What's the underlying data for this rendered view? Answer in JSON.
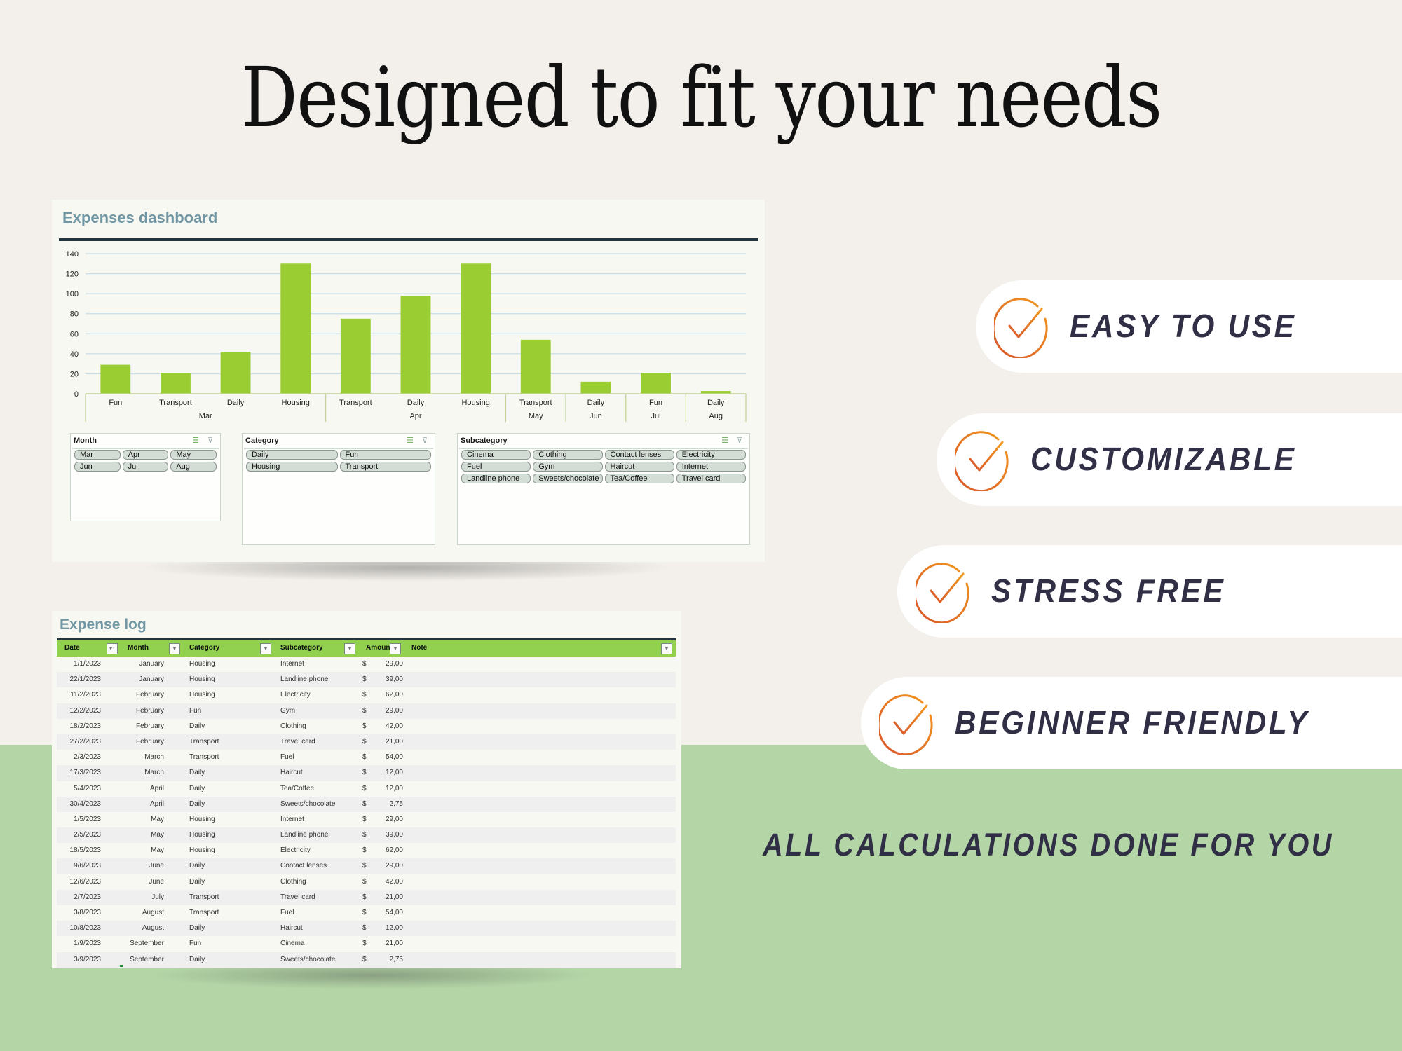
{
  "headline": "Designed to fit your needs",
  "dashboard": {
    "title": "Expenses dashboard",
    "slicers": [
      {
        "title": "Month",
        "columns": 3,
        "items": [
          "Mar",
          "Apr",
          "May",
          "Jun",
          "Jul",
          "Aug"
        ]
      },
      {
        "title": "Category",
        "columns": 2,
        "items": [
          "Daily",
          "Fun",
          "Housing",
          "Transport"
        ]
      },
      {
        "title": "Subcategory",
        "columns": 4,
        "items": [
          "Cinema",
          "Clothing",
          "Contact lenses",
          "Electricity",
          "Fuel",
          "Gym",
          "Haircut",
          "Internet",
          "Landline phone",
          "Sweets/chocolate",
          "Tea/Coffee",
          "Travel card"
        ]
      }
    ],
    "slicer_icons": {
      "multi_select": "multi-select-icon",
      "clear_filter": "clear-filter-icon"
    }
  },
  "chart_data": {
    "type": "bar",
    "title": "",
    "xlabel": "",
    "ylabel": "",
    "ylim": [
      0,
      140
    ],
    "yticks": [
      0,
      20,
      40,
      60,
      80,
      100,
      120,
      140
    ],
    "grid": true,
    "bar_color": "#9acd32",
    "categories": [
      "Fun",
      "Transport",
      "Daily",
      "Housing",
      "Transport",
      "Daily",
      "Housing",
      "Transport",
      "Daily",
      "Fun",
      "Daily"
    ],
    "groups": [
      {
        "label": "Mar",
        "count": 4
      },
      {
        "label": "Apr",
        "count": 3
      },
      {
        "label": "May",
        "count": 1
      },
      {
        "label": "Jun",
        "count": 1
      },
      {
        "label": "Jul",
        "count": 1
      },
      {
        "label": "Aug",
        "count": 1
      }
    ],
    "values": [
      29,
      21,
      42,
      130,
      75,
      98,
      130,
      54,
      12,
      21,
      2.75
    ]
  },
  "expense_log": {
    "title": "Expense log",
    "columns": [
      "Date",
      "Month",
      "Category",
      "Subcategory",
      "Amount",
      "Note"
    ],
    "currency": "$",
    "rows": [
      [
        "1/1/2023",
        "January",
        "Housing",
        "Internet",
        "29,00"
      ],
      [
        "22/1/2023",
        "January",
        "Housing",
        "Landline phone",
        "39,00"
      ],
      [
        "11/2/2023",
        "February",
        "Housing",
        "Electricity",
        "62,00"
      ],
      [
        "12/2/2023",
        "February",
        "Fun",
        "Gym",
        "29,00"
      ],
      [
        "18/2/2023",
        "February",
        "Daily",
        "Clothing",
        "42,00"
      ],
      [
        "27/2/2023",
        "February",
        "Transport",
        "Travel card",
        "21,00"
      ],
      [
        "2/3/2023",
        "March",
        "Transport",
        "Fuel",
        "54,00"
      ],
      [
        "17/3/2023",
        "March",
        "Daily",
        "Haircut",
        "12,00"
      ],
      [
        "5/4/2023",
        "April",
        "Daily",
        "Tea/Coffee",
        "12,00"
      ],
      [
        "30/4/2023",
        "April",
        "Daily",
        "Sweets/chocolate",
        "2,75"
      ],
      [
        "1/5/2023",
        "May",
        "Housing",
        "Internet",
        "29,00"
      ],
      [
        "2/5/2023",
        "May",
        "Housing",
        "Landline phone",
        "39,00"
      ],
      [
        "18/5/2023",
        "May",
        "Housing",
        "Electricity",
        "62,00"
      ],
      [
        "9/6/2023",
        "June",
        "Daily",
        "Contact lenses",
        "29,00"
      ],
      [
        "12/6/2023",
        "June",
        "Daily",
        "Clothing",
        "42,00"
      ],
      [
        "2/7/2023",
        "July",
        "Transport",
        "Travel card",
        "21,00"
      ],
      [
        "3/8/2023",
        "August",
        "Transport",
        "Fuel",
        "54,00"
      ],
      [
        "10/8/2023",
        "August",
        "Daily",
        "Haircut",
        "12,00"
      ],
      [
        "1/9/2023",
        "September",
        "Fun",
        "Cinema",
        "21,00"
      ],
      [
        "3/9/2023",
        "September",
        "Daily",
        "Sweets/chocolate",
        "2,75"
      ]
    ]
  },
  "features": [
    {
      "label": "EASY TO USE",
      "icon": "check-circle-icon"
    },
    {
      "label": "CUSTOMIZABLE",
      "icon": "check-circle-icon"
    },
    {
      "label": "STRESS FREE",
      "icon": "check-circle-icon"
    },
    {
      "label": "BEGINNER FRIENDLY",
      "icon": "check-circle-icon"
    }
  ],
  "footer_tagline": "ALL CALCULATIONS DONE FOR YOU",
  "colors": {
    "background": "#f3f0eb",
    "green_band": "#b4d6a7",
    "table_header": "#92d050",
    "panel_title": "#7097a3",
    "feature_text": "#302f45",
    "check_gradient_start": "#f29a1f",
    "check_gradient_end": "#d9552a"
  }
}
